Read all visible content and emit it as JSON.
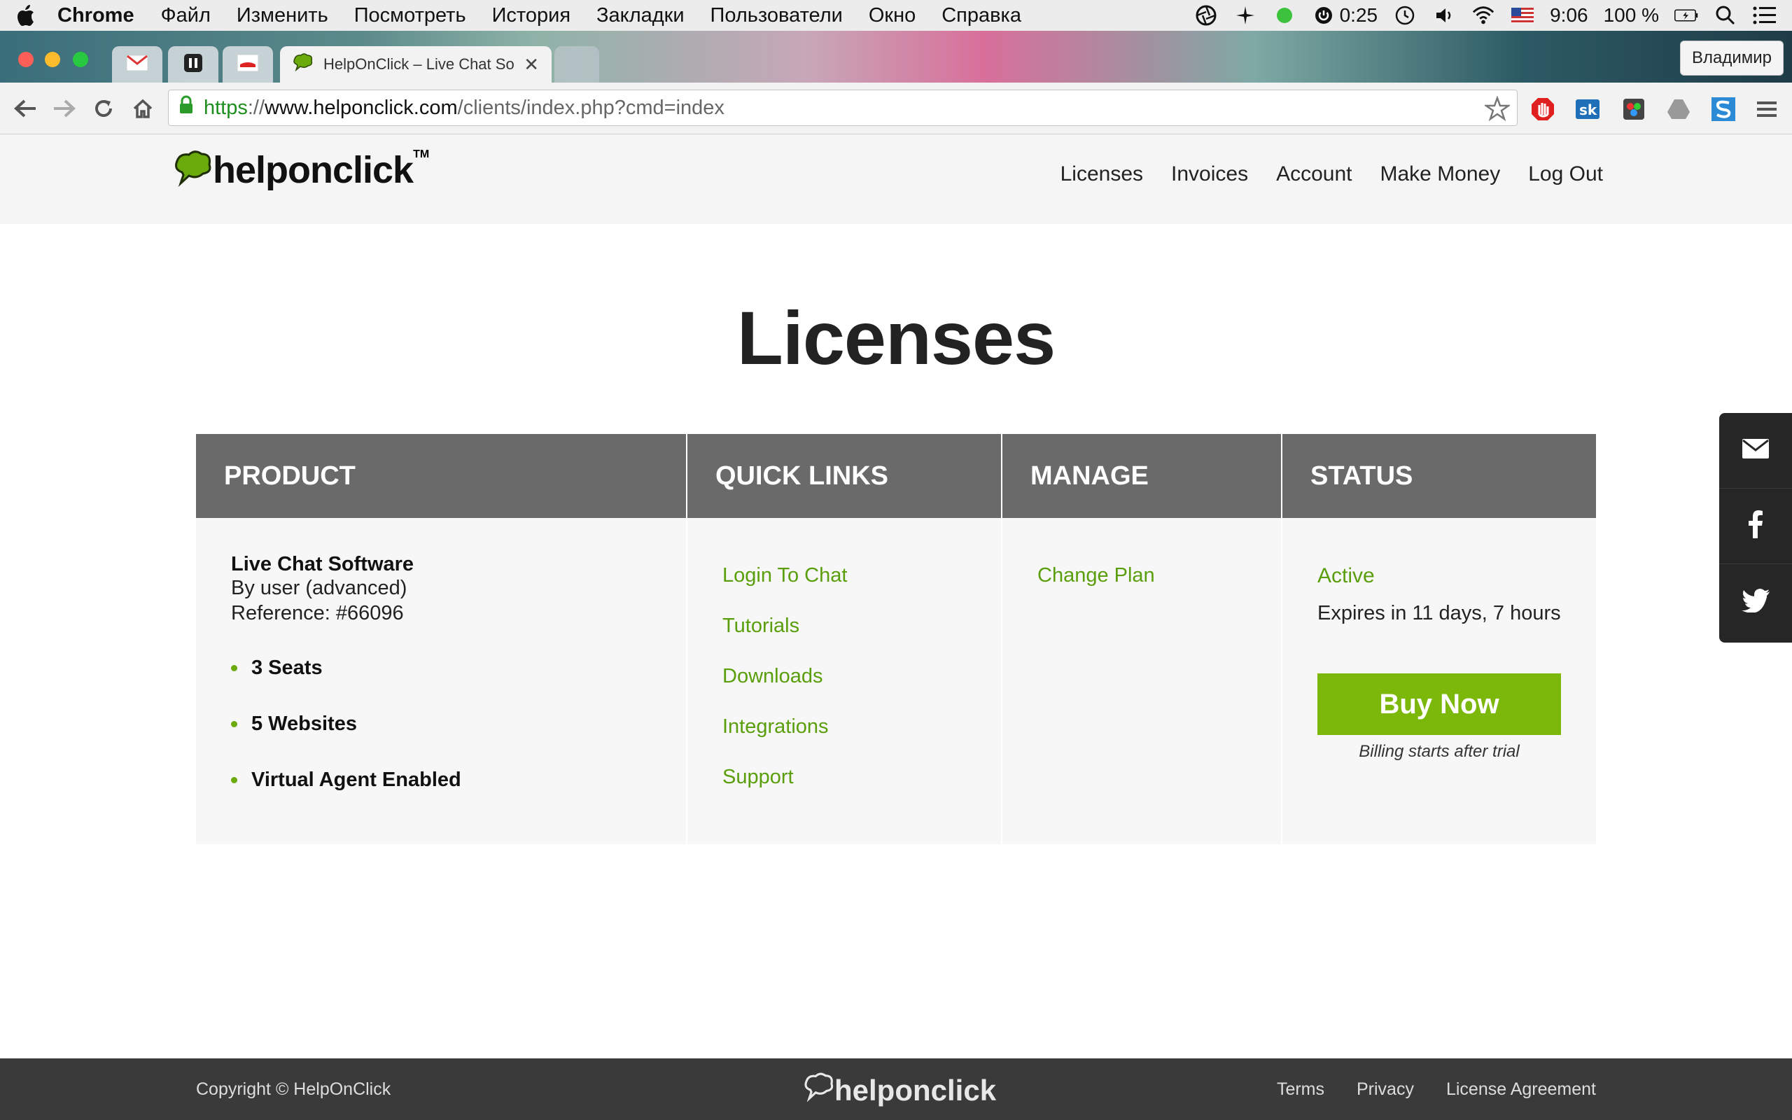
{
  "menubar": {
    "app": "Chrome",
    "items": [
      "Файл",
      "Изменить",
      "Посмотреть",
      "История",
      "Закладки",
      "Пользователи",
      "Окно",
      "Справка"
    ],
    "timer": "0:25",
    "clock": "9:06",
    "battery": "100 %"
  },
  "browser": {
    "active_tab_title": "HelpOnClick – Live Chat So",
    "profile": "Владимир",
    "url": {
      "scheme": "https",
      "sep": "://",
      "host": "www.helponclick.com",
      "path": "/clients/index.php?cmd=index"
    }
  },
  "site": {
    "logo": "helponclick",
    "logo_tm": "TM",
    "nav": [
      "Licenses",
      "Invoices",
      "Account",
      "Make Money",
      "Log Out"
    ],
    "page_title": "Licenses"
  },
  "table": {
    "headers": [
      "PRODUCT",
      "QUICK LINKS",
      "MANAGE",
      "STATUS"
    ],
    "product": {
      "name": "Live Chat Software",
      "by": "By user (advanced)",
      "reference": "Reference: #66096",
      "features": [
        "3 Seats",
        "5 Websites",
        "Virtual Agent Enabled"
      ]
    },
    "quick_links": [
      "Login To Chat",
      "Tutorials",
      "Downloads",
      "Integrations",
      "Support"
    ],
    "manage": [
      "Change Plan"
    ],
    "status": {
      "state": "Active",
      "expires": "Expires in 11 days, 7 hours",
      "buy_label": "Buy Now",
      "billing_note": "Billing starts after trial"
    }
  },
  "footer": {
    "copyright": "Copyright © HelpOnClick",
    "logo": "helponclick",
    "links": [
      "Terms",
      "Privacy",
      "License Agreement"
    ]
  },
  "colors": {
    "accent_green": "#7cb809",
    "link_green": "#5a9e0c",
    "header_gray": "#6a6a6a"
  }
}
